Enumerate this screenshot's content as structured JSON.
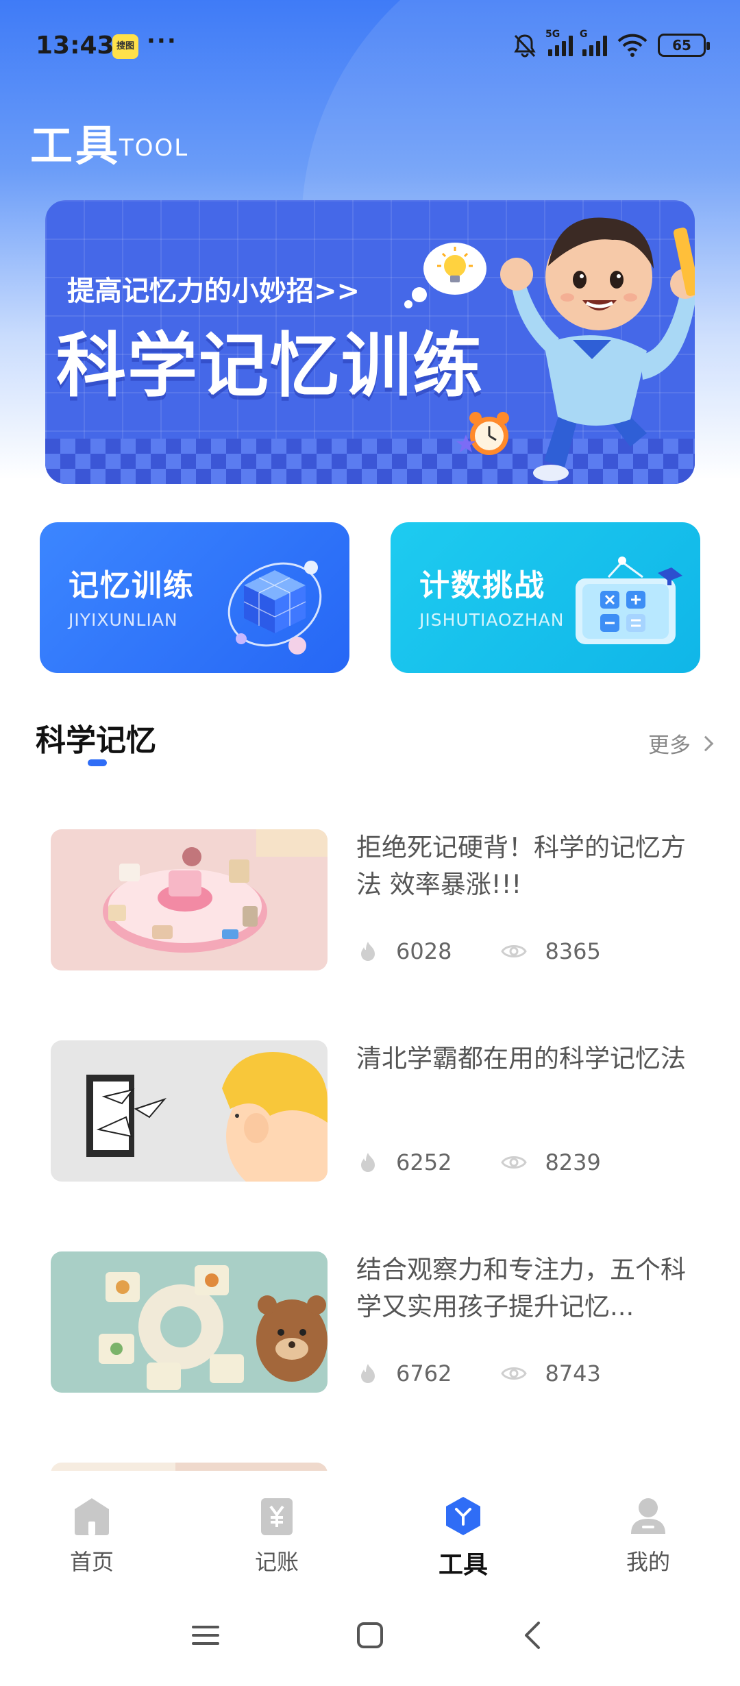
{
  "status_bar": {
    "time": "13:43",
    "app_badge": "搜图",
    "more": "···",
    "network_5g": "5G",
    "network_g": "G",
    "battery": "65"
  },
  "header": {
    "title": "工具",
    "subtitle": "TOOL"
  },
  "banner": {
    "tagline": "提高记忆力的小妙招>>",
    "headline": "科学记忆训练"
  },
  "quick_cards": [
    {
      "title": "记忆训练",
      "subtitle": "JIYIXUNLIAN",
      "icon": "cube-icon",
      "color": "#2f74fb"
    },
    {
      "title": "计数挑战",
      "subtitle": "JISHUTIAOZHAN",
      "icon": "calculator-board-icon",
      "color": "#17c0ec"
    }
  ],
  "section": {
    "title": "科学记忆",
    "more_label": "更多"
  },
  "articles": [
    {
      "title": "拒绝死记硬背！科学的记忆方法 效率暴涨!!!",
      "hot": "6028",
      "views": "8365",
      "thumb": "pink-desk-toys"
    },
    {
      "title": "清北学霸都在用的科学记忆法",
      "hot": "6252",
      "views": "8239",
      "thumb": "child-head-door"
    },
    {
      "title": "结合观察力和专注力，五个科学又实用孩子提升记忆...",
      "hot": "6762",
      "views": "8743",
      "thumb": "puzzle-bear"
    }
  ],
  "tab_bar": [
    {
      "label": "首页",
      "icon": "home-icon",
      "active": false
    },
    {
      "label": "记账",
      "icon": "ledger-icon",
      "active": false
    },
    {
      "label": "工具",
      "icon": "tools-icon",
      "active": true
    },
    {
      "label": "我的",
      "icon": "profile-icon",
      "active": false
    }
  ],
  "colors": {
    "accent": "#2f6df6",
    "header_gradient_top": "#3f7bf7",
    "banner_bg": "#4568e8",
    "inactive_icon": "#c8c8c8"
  }
}
